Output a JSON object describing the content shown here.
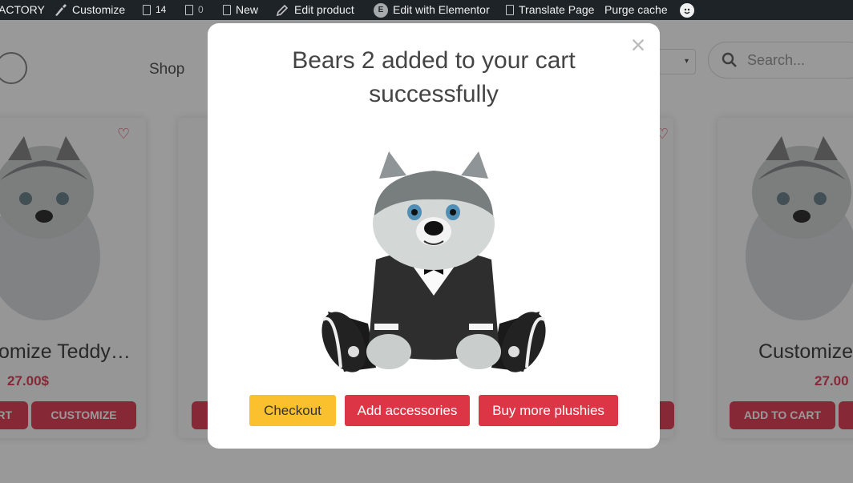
{
  "admin_bar": {
    "site_name": "ACTORY",
    "customize": "Customize",
    "updates_count": "14",
    "comments_count": "0",
    "new_label": "New",
    "edit_product": "Edit product",
    "edit_with_elementor": "Edit with Elementor",
    "translate_page": "Translate Page",
    "purge_cache": "Purge cache"
  },
  "header": {
    "nav_shop": "Shop",
    "search_placeholder": "Search..."
  },
  "products": [
    {
      "title": "omize Teddy…",
      "price": "27.00$",
      "btn_cart": "RT",
      "btn_customize": "CUSTOMIZE"
    },
    {
      "title": "Customize",
      "price": "27.00",
      "btn_cart": "ADD TO CART"
    }
  ],
  "modal": {
    "title": "Bears 2 added to your cart successfully",
    "close_symbol": "×",
    "buttons": {
      "checkout": "Checkout",
      "add_accessories": "Add accessories",
      "buy_more": "Buy more plushies"
    }
  },
  "colors": {
    "admin_bar": "#1d2327",
    "accent_red": "#dc3545",
    "checkout_yellow": "#fbc02d"
  }
}
